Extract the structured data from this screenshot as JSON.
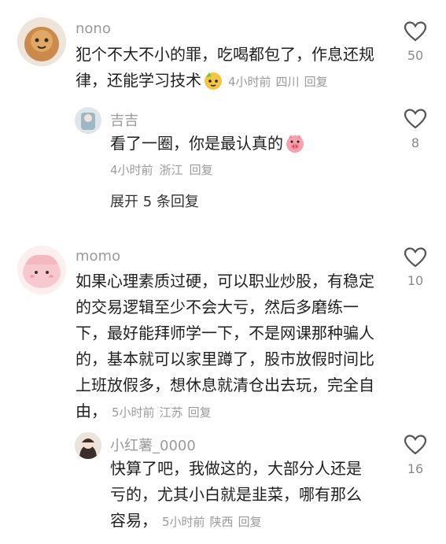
{
  "comments": [
    {
      "username": "nono",
      "lines": [
        "犯个不大不小的罪，吃喝都包了，作息还规",
        "律，还能学习技术"
      ],
      "meta": {
        "time": "4小时前",
        "location": "四川",
        "reply": "回复"
      },
      "likes": "50",
      "avatar_color": "#c98a4b",
      "emoji": "cute-face",
      "replies": [
        {
          "username": "吉吉",
          "lines": [
            "看了一圈，你是最认真的"
          ],
          "meta": {
            "time": "4小时前",
            "location": "浙江",
            "reply": "回复"
          },
          "likes": "8",
          "emoji": "pig-face"
        }
      ],
      "expand_label": "展开 5 条回复"
    },
    {
      "username": "momo",
      "lines": [
        "如果心理素质过硬，可以职业炒股，有稳定",
        "的交易逻辑至少不会大亏，然后多磨练一",
        "下，最好能拜师学一下，不是网课那种骗人",
        "的，基本就可以家里蹲了，股市放假时间比",
        "上班放假多，想休息就清仓出去玩，完全自",
        "由，"
      ],
      "meta": {
        "time": "5小时前",
        "location": "江苏",
        "reply": "回复"
      },
      "likes": "10",
      "avatar_color": "#f7c9cf",
      "replies": [
        {
          "username": "小红薯_0000",
          "lines": [
            "快算了吧，我做这的，大部分人还是",
            "亏的，尤其小白就是韭菜，哪有那么",
            "容易，"
          ],
          "meta": {
            "time": "5小时前",
            "location": "陕西",
            "reply": "回复"
          },
          "likes": "16"
        }
      ]
    }
  ],
  "colors": {
    "text": "#1f1f1f",
    "meta": "#9a9a9a",
    "icon": "#555555"
  }
}
